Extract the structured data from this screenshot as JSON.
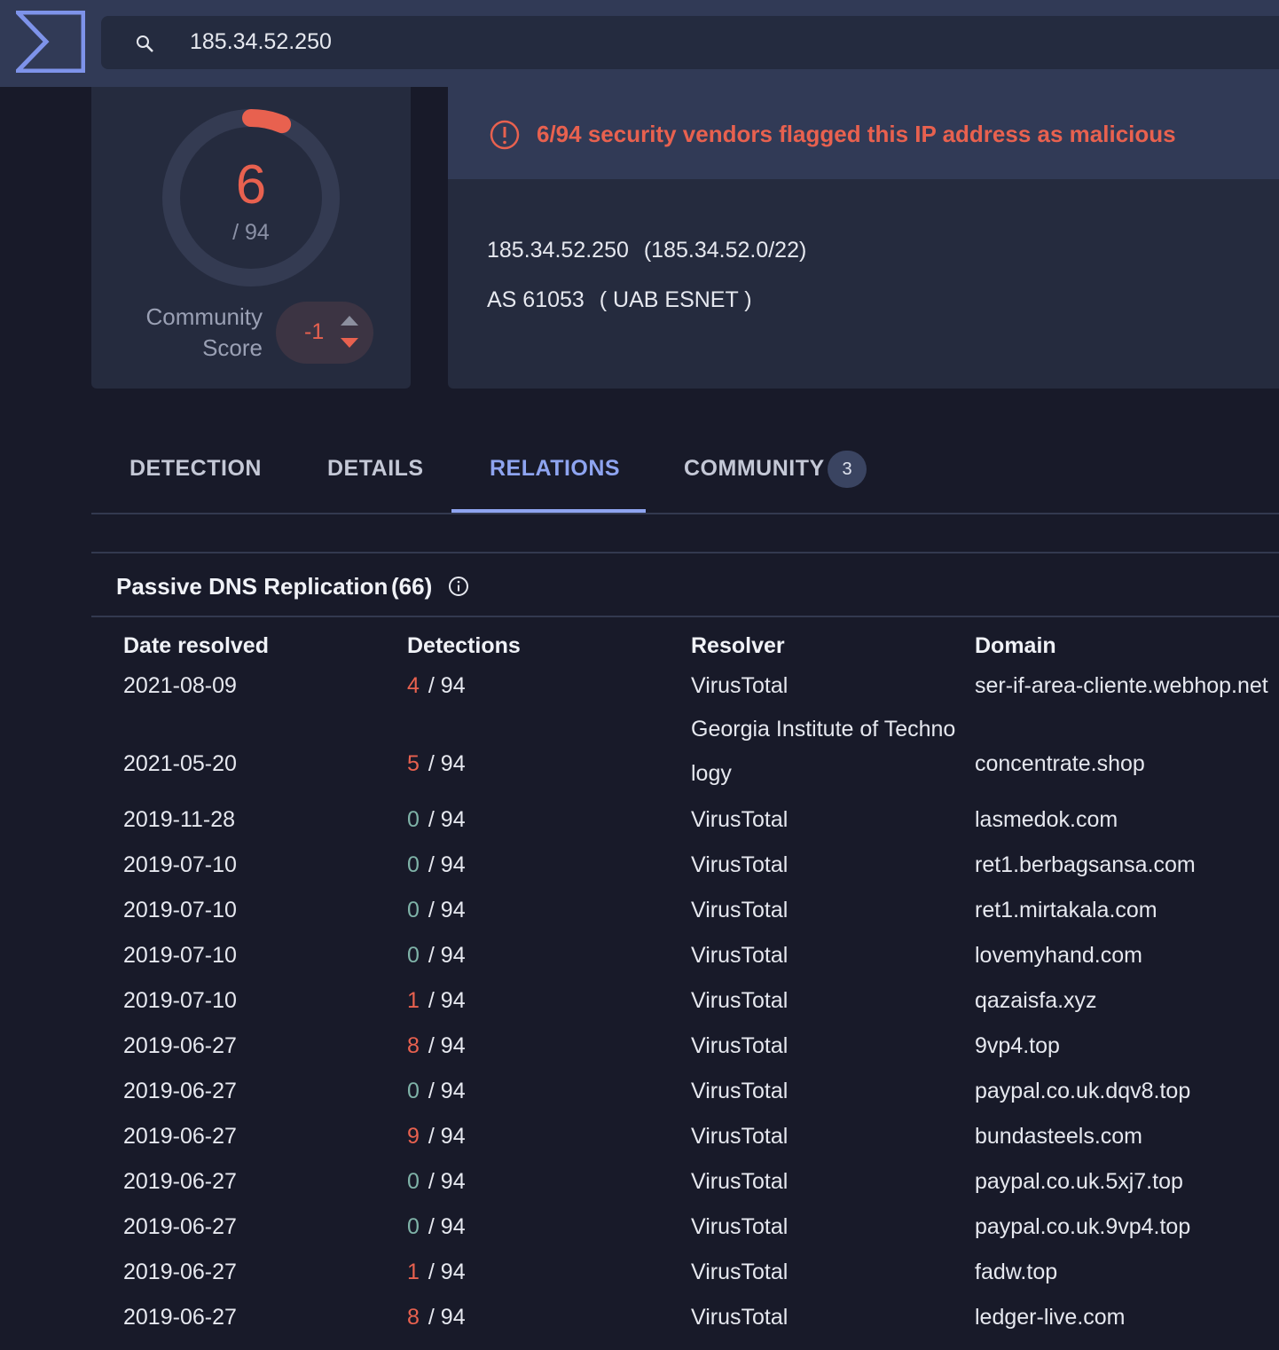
{
  "search": {
    "value": "185.34.52.250"
  },
  "score": {
    "detected": "6",
    "total": "/ 94",
    "community_label_line1": "Community",
    "community_label_line2": "Score",
    "community_value": "-1"
  },
  "alert": {
    "text": "6/94 security vendors flagged this IP address as malicious"
  },
  "ip_info": {
    "ip": "185.34.52.250",
    "range": "(185.34.52.0/22)",
    "asn": "AS 61053",
    "owner": "( UAB ESNET )"
  },
  "tabs": [
    {
      "label": "DETECTION"
    },
    {
      "label": "DETAILS"
    },
    {
      "label": "RELATIONS"
    },
    {
      "label": "COMMUNITY",
      "badge": "3"
    }
  ],
  "section": {
    "title": "Passive DNS Replication",
    "count": "(66)"
  },
  "table": {
    "headers": [
      "Date resolved",
      "Detections",
      "Resolver",
      "Domain"
    ],
    "total_label": "/ 94",
    "rows": [
      {
        "date": "2021-08-09",
        "det": "4",
        "resolver": "VirusTotal",
        "domain": "ser-if-area-cliente.webhop.net"
      },
      {
        "date": "2021-05-20",
        "det": "5",
        "resolver": "Georgia Institute of Technology",
        "domain": "concentrate.shop"
      },
      {
        "date": "2019-11-28",
        "det": "0",
        "resolver": "VirusTotal",
        "domain": "lasmedok.com"
      },
      {
        "date": "2019-07-10",
        "det": "0",
        "resolver": "VirusTotal",
        "domain": "ret1.berbagsansa.com"
      },
      {
        "date": "2019-07-10",
        "det": "0",
        "resolver": "VirusTotal",
        "domain": "ret1.mirtakala.com"
      },
      {
        "date": "2019-07-10",
        "det": "0",
        "resolver": "VirusTotal",
        "domain": "lovemyhand.com"
      },
      {
        "date": "2019-07-10",
        "det": "1",
        "resolver": "VirusTotal",
        "domain": "qazaisfa.xyz"
      },
      {
        "date": "2019-06-27",
        "det": "8",
        "resolver": "VirusTotal",
        "domain": "9vp4.top"
      },
      {
        "date": "2019-06-27",
        "det": "0",
        "resolver": "VirusTotal",
        "domain": "paypal.co.uk.dqv8.top"
      },
      {
        "date": "2019-06-27",
        "det": "9",
        "resolver": "VirusTotal",
        "domain": "bundasteels.com"
      },
      {
        "date": "2019-06-27",
        "det": "0",
        "resolver": "VirusTotal",
        "domain": "paypal.co.uk.5xj7.top"
      },
      {
        "date": "2019-06-27",
        "det": "0",
        "resolver": "VirusTotal",
        "domain": "paypal.co.uk.9vp4.top"
      },
      {
        "date": "2019-06-27",
        "det": "1",
        "resolver": "VirusTotal",
        "domain": "fadw.top"
      },
      {
        "date": "2019-06-27",
        "det": "8",
        "resolver": "VirusTotal",
        "domain": "ledger-live.com"
      }
    ]
  },
  "colors": {
    "malicious": "#e8614f",
    "clean": "#7fb3a8",
    "accent": "#8ea4f0"
  },
  "icons": {
    "logo": "sigma-logo-icon",
    "search": "search-icon",
    "alert": "alert-circle-icon",
    "info": "info-icon"
  }
}
